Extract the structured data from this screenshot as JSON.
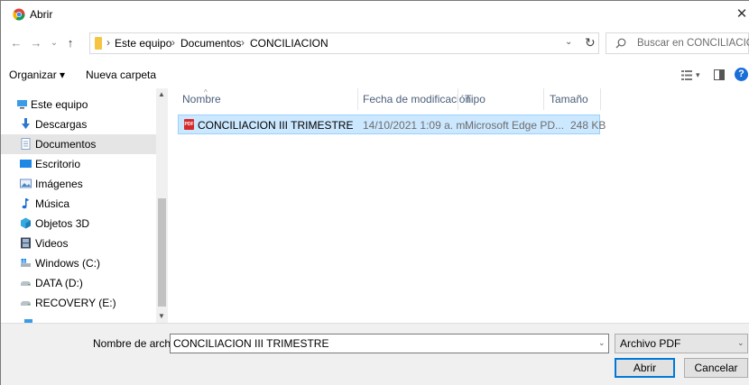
{
  "window": {
    "title": "Abrir",
    "close_glyph": "✕"
  },
  "nav": {
    "back": "←",
    "forward": "→",
    "recent": "⌄",
    "up": "↑"
  },
  "address": {
    "segments": [
      "Este equipo",
      "Documentos",
      "CONCILIACION"
    ],
    "separator": "›",
    "dropdown": "⌄",
    "refresh": "↻"
  },
  "search": {
    "placeholder": "Buscar en CONCILIACION"
  },
  "toolbar": {
    "organize": "Organizar ▾",
    "new_folder": "Nueva carpeta",
    "view_options": "▾",
    "help": "?"
  },
  "sidebar": {
    "items": [
      {
        "label": "Este equipo",
        "icon": "computer-icon"
      },
      {
        "label": "Descargas",
        "icon": "downloads-icon"
      },
      {
        "label": "Documentos",
        "icon": "documents-icon",
        "selected": true
      },
      {
        "label": "Escritorio",
        "icon": "desktop-icon"
      },
      {
        "label": "Imágenes",
        "icon": "pictures-icon"
      },
      {
        "label": "Música",
        "icon": "music-icon"
      },
      {
        "label": "Objetos 3D",
        "icon": "3d-objects-icon"
      },
      {
        "label": "Videos",
        "icon": "videos-icon"
      },
      {
        "label": "Windows (C:)",
        "icon": "windows-drive-icon"
      },
      {
        "label": "DATA (D:)",
        "icon": "drive-icon"
      },
      {
        "label": "RECOVERY (E:)",
        "icon": "drive-icon"
      }
    ]
  },
  "file_list": {
    "columns": [
      "Nombre",
      "Fecha de modificación",
      "Tipo",
      "Tamaño"
    ],
    "rows": [
      {
        "name": "CONCILIACION III TRIMESTRE",
        "modified": "14/10/2021 1:09 a. m.",
        "type": "Microsoft Edge PD...",
        "size": "248 KB",
        "icon": "pdf-icon",
        "selected": true
      }
    ]
  },
  "footer": {
    "filename_label": "Nombre de archivo:",
    "filename_value": "CONCILIACION III TRIMESTRE",
    "filetype": "Archivo PDF",
    "open": "Abrir",
    "cancel": "Cancelar"
  },
  "colors": {
    "accent": "#0078d7",
    "selection": "#cce8ff",
    "pdf": "#d42a2a",
    "help": "#1a6fd6"
  }
}
